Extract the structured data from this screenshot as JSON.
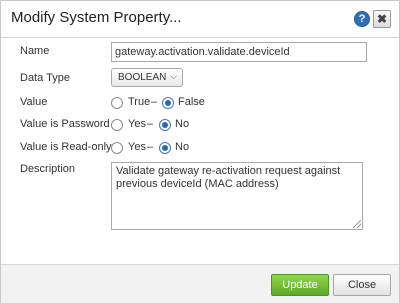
{
  "dialog": {
    "title": "Modify System Property...",
    "help_icon": "?",
    "close_icon": "✖"
  },
  "form": {
    "name": {
      "label": "Name",
      "value": "gateway.activation.validate.deviceId"
    },
    "data_type": {
      "label": "Data Type",
      "selected": "BOOLEAN"
    },
    "value": {
      "label": "Value",
      "options": [
        "True",
        "False"
      ],
      "separator": "–",
      "selected": "False"
    },
    "is_password": {
      "label": "Value is Password",
      "options": [
        "Yes",
        "No"
      ],
      "separator": "–",
      "selected": "No"
    },
    "is_readonly": {
      "label": "Value is Read-only",
      "options": [
        "Yes",
        "No"
      ],
      "separator": "–",
      "selected": "No"
    },
    "description": {
      "label": "Description",
      "value": "Validate gateway re-activation request against previous deviceId (MAC address)"
    }
  },
  "footer": {
    "update_label": "Update",
    "close_label": "Close"
  },
  "colors": {
    "primary_button": "#6cbf3a",
    "radio_selected": "#2a66b8",
    "help_icon_bg": "#2f6fb5"
  }
}
